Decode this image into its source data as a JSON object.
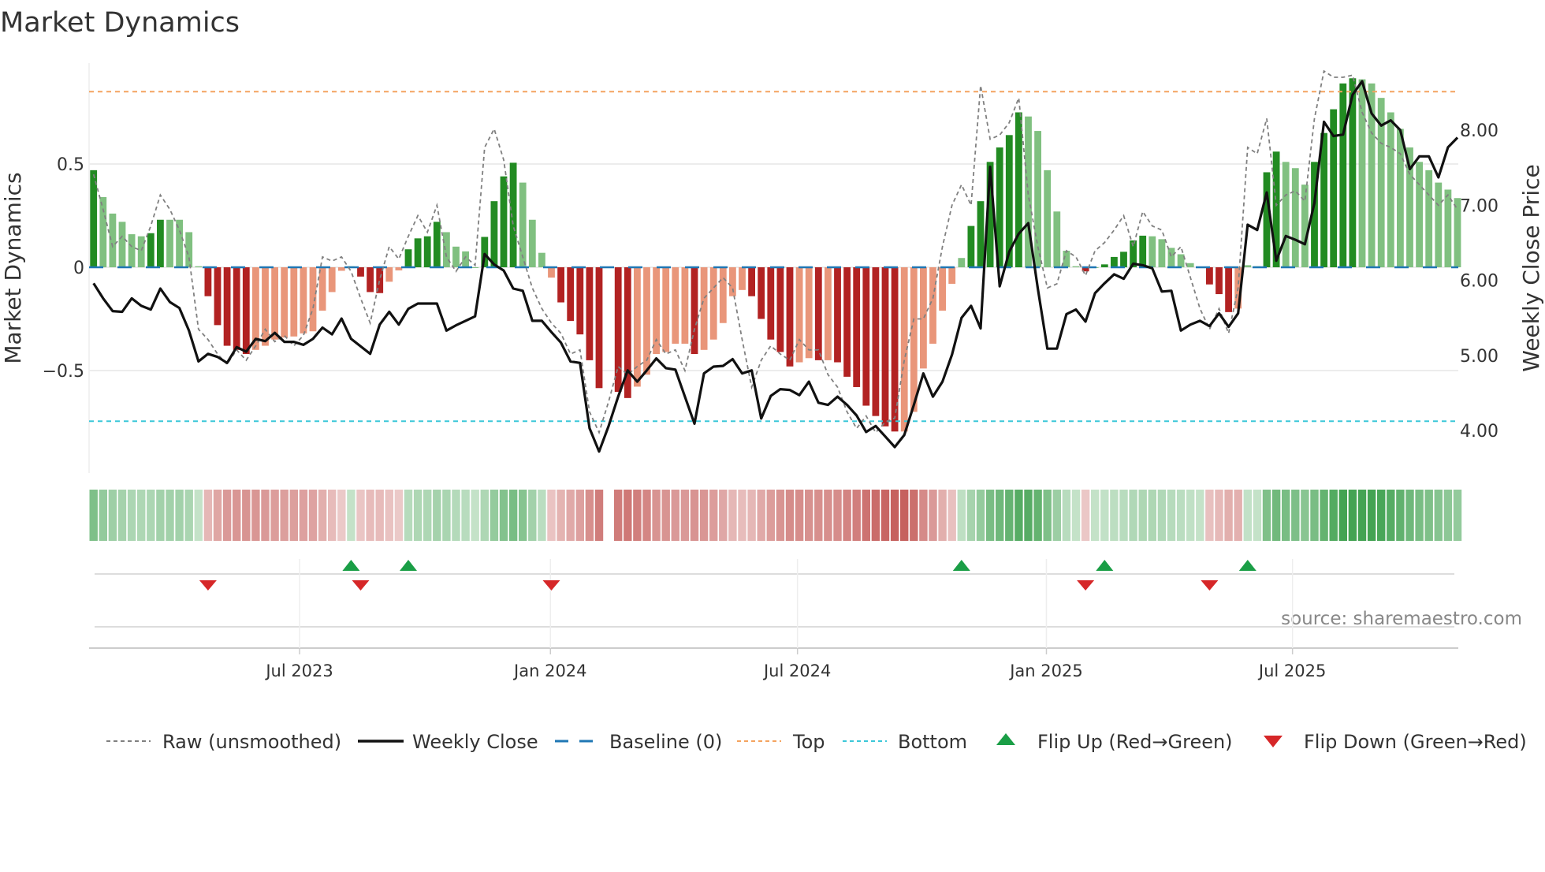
{
  "chart_data": {
    "type": "bar",
    "title": "Market Dynamics",
    "ylabel": "Market Dynamics",
    "ylabel_right": "Weekly Close Price",
    "source": "source: sharemaestro.com",
    "ylim": [
      -0.99,
      0.99
    ],
    "ylim_right": [
      3.43,
      8.89
    ],
    "x_unit": "week index",
    "yticks": [
      {
        "v": 0.5,
        "label": "0.5"
      },
      {
        "v": 0,
        "label": "0"
      },
      {
        "v": -0.5,
        "label": "−0.5"
      }
    ],
    "yticks_right": [
      {
        "v": 8,
        "label": "8.00"
      },
      {
        "v": 7,
        "label": "7.00"
      },
      {
        "v": 6,
        "label": "6.00"
      },
      {
        "v": 5,
        "label": "5.00"
      },
      {
        "v": 4,
        "label": "4.00"
      }
    ],
    "xticks": [
      {
        "x": 21.6,
        "label": "Jul 2023"
      },
      {
        "x": 47.9,
        "label": "Jan 2024"
      },
      {
        "x": 73.8,
        "label": "Jul 2024"
      },
      {
        "x": 99.9,
        "label": "Jan 2025"
      },
      {
        "x": 125.7,
        "label": "Jul 2025"
      }
    ],
    "top_level": 0.85,
    "bottom_level": -0.745,
    "baseline": 0,
    "momentum": [
      0.47,
      0.34,
      0.26,
      0.22,
      0.16,
      0.15,
      0.165,
      0.23,
      0.23,
      0.23,
      0.17,
      0.005,
      -0.14,
      -0.28,
      -0.38,
      -0.4,
      -0.42,
      -0.4,
      -0.38,
      -0.35,
      -0.34,
      -0.335,
      -0.32,
      -0.31,
      -0.21,
      -0.12,
      -0.017,
      0.005,
      -0.045,
      -0.12,
      -0.125,
      -0.07,
      -0.015,
      0.087,
      0.14,
      0.15,
      0.22,
      0.17,
      0.1,
      0.077,
      0.0,
      0.147,
      0.32,
      0.44,
      0.506,
      0.41,
      0.23,
      0.07,
      -0.05,
      -0.17,
      -0.26,
      -0.325,
      -0.45,
      -0.585,
      null,
      -0.603,
      -0.633,
      -0.578,
      -0.52,
      -0.42,
      -0.41,
      -0.37,
      -0.37,
      -0.42,
      -0.4,
      -0.35,
      -0.27,
      -0.14,
      -0.11,
      -0.14,
      -0.25,
      -0.35,
      -0.41,
      -0.48,
      -0.46,
      -0.44,
      -0.45,
      -0.45,
      -0.46,
      -0.53,
      -0.58,
      -0.67,
      -0.72,
      -0.77,
      -0.795,
      -0.795,
      -0.7,
      -0.49,
      -0.37,
      -0.21,
      -0.08,
      0.045,
      0.2,
      0.32,
      0.51,
      0.58,
      0.64,
      0.75,
      0.73,
      0.66,
      0.47,
      0.27,
      0.08,
      0.005,
      -0.02,
      0.0,
      0.014,
      0.05,
      0.075,
      0.13,
      0.153,
      0.15,
      0.136,
      0.094,
      0.063,
      0.02,
      0.0,
      -0.083,
      -0.13,
      -0.217,
      -0.2,
      0.01,
      0.005,
      0.46,
      0.56,
      0.51,
      0.48,
      0.4,
      0.51,
      0.65,
      0.765,
      0.89,
      0.915,
      0.91,
      0.89,
      0.82,
      0.75,
      0.67,
      0.58,
      0.51,
      0.47,
      0.41,
      0.376,
      0.335
    ],
    "raw": [
      0.45,
      0.28,
      0.1,
      0.15,
      0.1,
      0.08,
      0.2,
      0.35,
      0.28,
      0.18,
      0.05,
      -0.3,
      -0.35,
      -0.42,
      -0.47,
      -0.4,
      -0.45,
      -0.38,
      -0.3,
      -0.36,
      -0.33,
      -0.38,
      -0.33,
      -0.2,
      0.05,
      0.03,
      0.05,
      -0.02,
      -0.15,
      -0.27,
      -0.06,
      0.1,
      0.04,
      0.15,
      0.25,
      0.17,
      0.3,
      0.05,
      -0.02,
      0.05,
      0.01,
      0.58,
      0.67,
      0.52,
      0.2,
      0.05,
      -0.1,
      -0.2,
      -0.27,
      -0.32,
      -0.42,
      -0.4,
      -0.7,
      -0.8,
      -0.65,
      -0.48,
      -0.52,
      -0.48,
      -0.45,
      -0.35,
      -0.42,
      -0.4,
      -0.5,
      -0.3,
      -0.15,
      -0.1,
      -0.05,
      -0.1,
      -0.35,
      -0.58,
      -0.45,
      -0.38,
      -0.42,
      -0.45,
      -0.35,
      -0.4,
      -0.4,
      -0.52,
      -0.58,
      -0.7,
      -0.78,
      -0.72,
      -0.8,
      -0.75,
      -0.73,
      -0.45,
      -0.25,
      -0.25,
      -0.15,
      0.1,
      0.3,
      0.4,
      0.3,
      0.88,
      0.62,
      0.64,
      0.7,
      0.82,
      0.35,
      0.1,
      -0.1,
      -0.08,
      0.08,
      0.05,
      -0.04,
      0.08,
      0.12,
      0.18,
      0.25,
      0.1,
      0.27,
      0.2,
      0.18,
      0.05,
      0.1,
      -0.05,
      -0.2,
      -0.3,
      -0.2,
      -0.32,
      -0.1,
      0.58,
      0.55,
      0.72,
      0.3,
      0.35,
      0.37,
      0.32,
      0.72,
      0.95,
      0.92,
      0.92,
      0.93,
      0.75,
      0.65,
      0.6,
      0.58,
      0.55,
      0.45,
      0.4,
      0.35,
      0.3,
      0.35,
      0.28
    ],
    "weekly_close": [
      5.96,
      5.76,
      5.59,
      5.58,
      5.76,
      5.66,
      5.61,
      5.89,
      5.71,
      5.63,
      5.33,
      4.92,
      5.02,
      4.98,
      4.9,
      5.11,
      5.05,
      5.22,
      5.19,
      5.3,
      5.18,
      5.18,
      5.14,
      5.22,
      5.37,
      5.28,
      5.49,
      5.22,
      5.12,
      5.02,
      5.41,
      5.58,
      5.41,
      5.62,
      5.69,
      5.69,
      5.69,
      5.33,
      5.4,
      5.46,
      5.52,
      6.35,
      6.21,
      6.13,
      5.89,
      5.86,
      5.46,
      5.46,
      5.31,
      5.17,
      4.92,
      4.9,
      4.03,
      3.72,
      4.06,
      4.45,
      4.8,
      4.65,
      4.8,
      4.96,
      4.83,
      4.81,
      4.45,
      4.09,
      4.76,
      4.85,
      4.86,
      4.95,
      4.76,
      4.8,
      4.16,
      4.46,
      4.55,
      4.54,
      4.47,
      4.65,
      4.37,
      4.34,
      4.45,
      4.34,
      4.2,
      3.98,
      4.06,
      3.92,
      3.78,
      3.94,
      4.34,
      4.76,
      4.45,
      4.65,
      5.01,
      5.5,
      5.66,
      5.36,
      7.51,
      5.92,
      6.38,
      6.62,
      6.76,
      5.89,
      5.09,
      5.09,
      5.55,
      5.61,
      5.45,
      5.83,
      5.96,
      6.08,
      6.02,
      6.22,
      6.2,
      6.16,
      5.85,
      5.86,
      5.33,
      5.41,
      5.46,
      5.39,
      5.56,
      5.38,
      5.56,
      6.74,
      6.67,
      7.17,
      6.26,
      6.59,
      6.54,
      6.48,
      7.03,
      8.11,
      7.92,
      7.94,
      8.47,
      8.65,
      8.22,
      8.06,
      8.13,
      8.0,
      7.48,
      7.65,
      7.65,
      7.37,
      7.77,
      7.9
    ],
    "flip_up": [
      27,
      33,
      91,
      106,
      121
    ],
    "flip_down": [
      12,
      28,
      48,
      104,
      117
    ],
    "legend": {
      "placement": "bottom",
      "items": [
        {
          "key": "raw",
          "label": "Raw (unsmoothed)"
        },
        {
          "key": "close",
          "label": "Weekly Close"
        },
        {
          "key": "baseline",
          "label": "Baseline (0)"
        },
        {
          "key": "top",
          "label": "Top"
        },
        {
          "key": "bottom",
          "label": "Bottom"
        },
        {
          "key": "flip_up",
          "label": "Flip Up (Red→Green)"
        },
        {
          "key": "flip_down",
          "label": "Flip Down (Green→Red)"
        }
      ]
    },
    "colors": {
      "green_strong": "#228b22",
      "green_weak": "#80c080",
      "red_strong": "#b22222",
      "red_weak": "#e9967a",
      "top": "#f4a460",
      "bottom": "#3cc8d8",
      "baseline": "#1f77b4",
      "raw": "#808080",
      "close": "#111111",
      "flip_up": "#1a9e46",
      "flip_down": "#d62728"
    }
  }
}
